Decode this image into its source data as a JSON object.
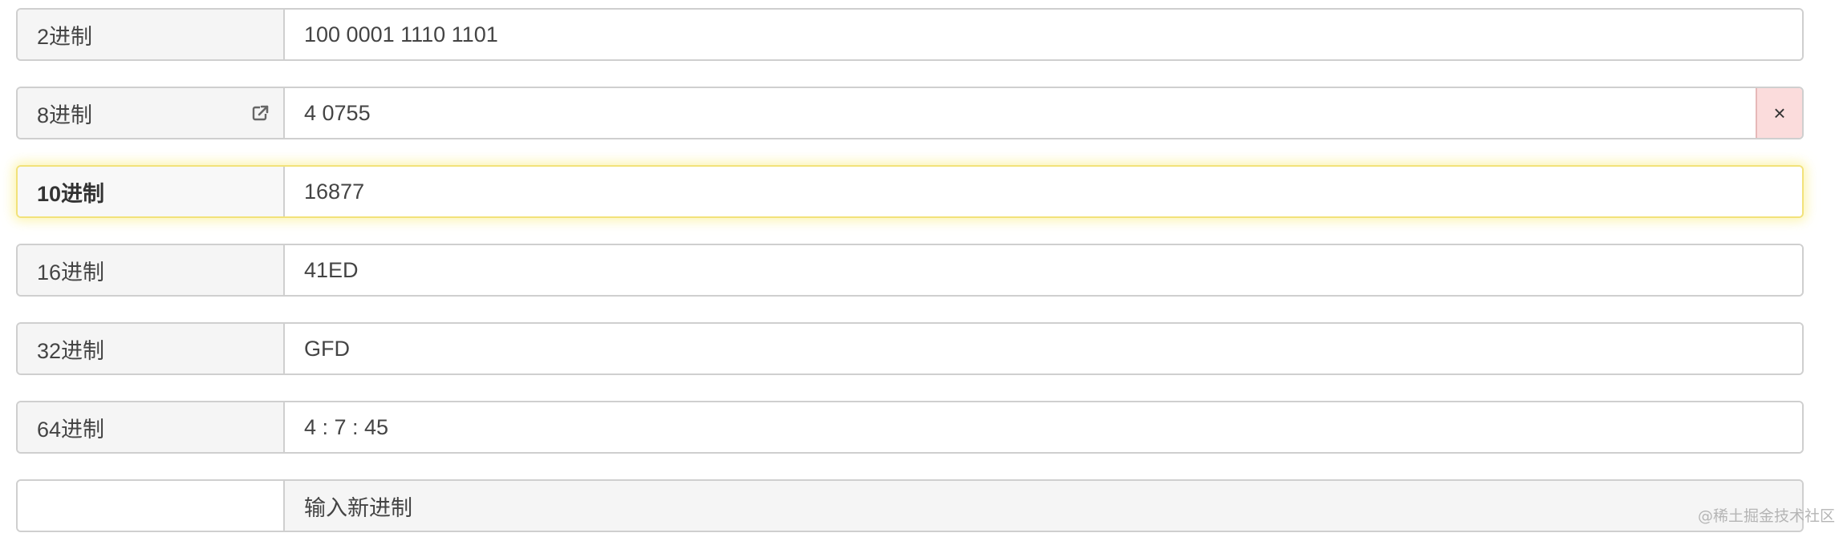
{
  "rows": [
    {
      "label": "2进制",
      "value": "100 0001 1110 1101"
    },
    {
      "label": "8进制",
      "value": "4 0755",
      "icon": "external-link-icon",
      "clear_label": "×"
    },
    {
      "label": "10进制",
      "value": "16877"
    },
    {
      "label": "16进制",
      "value": "41ED"
    },
    {
      "label": "32进制",
      "value": "GFD"
    },
    {
      "label": "64进制",
      "value": "4 : 7 : 45"
    }
  ],
  "new_row": {
    "label": "",
    "placeholder": "输入新进制"
  },
  "watermark": "@稀土掘金技术社区",
  "colors": {
    "label_bg": "#f5f5f5",
    "border": "#cfcfcf",
    "clear_bg": "#fbdcdc",
    "active_glow": "#faec78"
  }
}
